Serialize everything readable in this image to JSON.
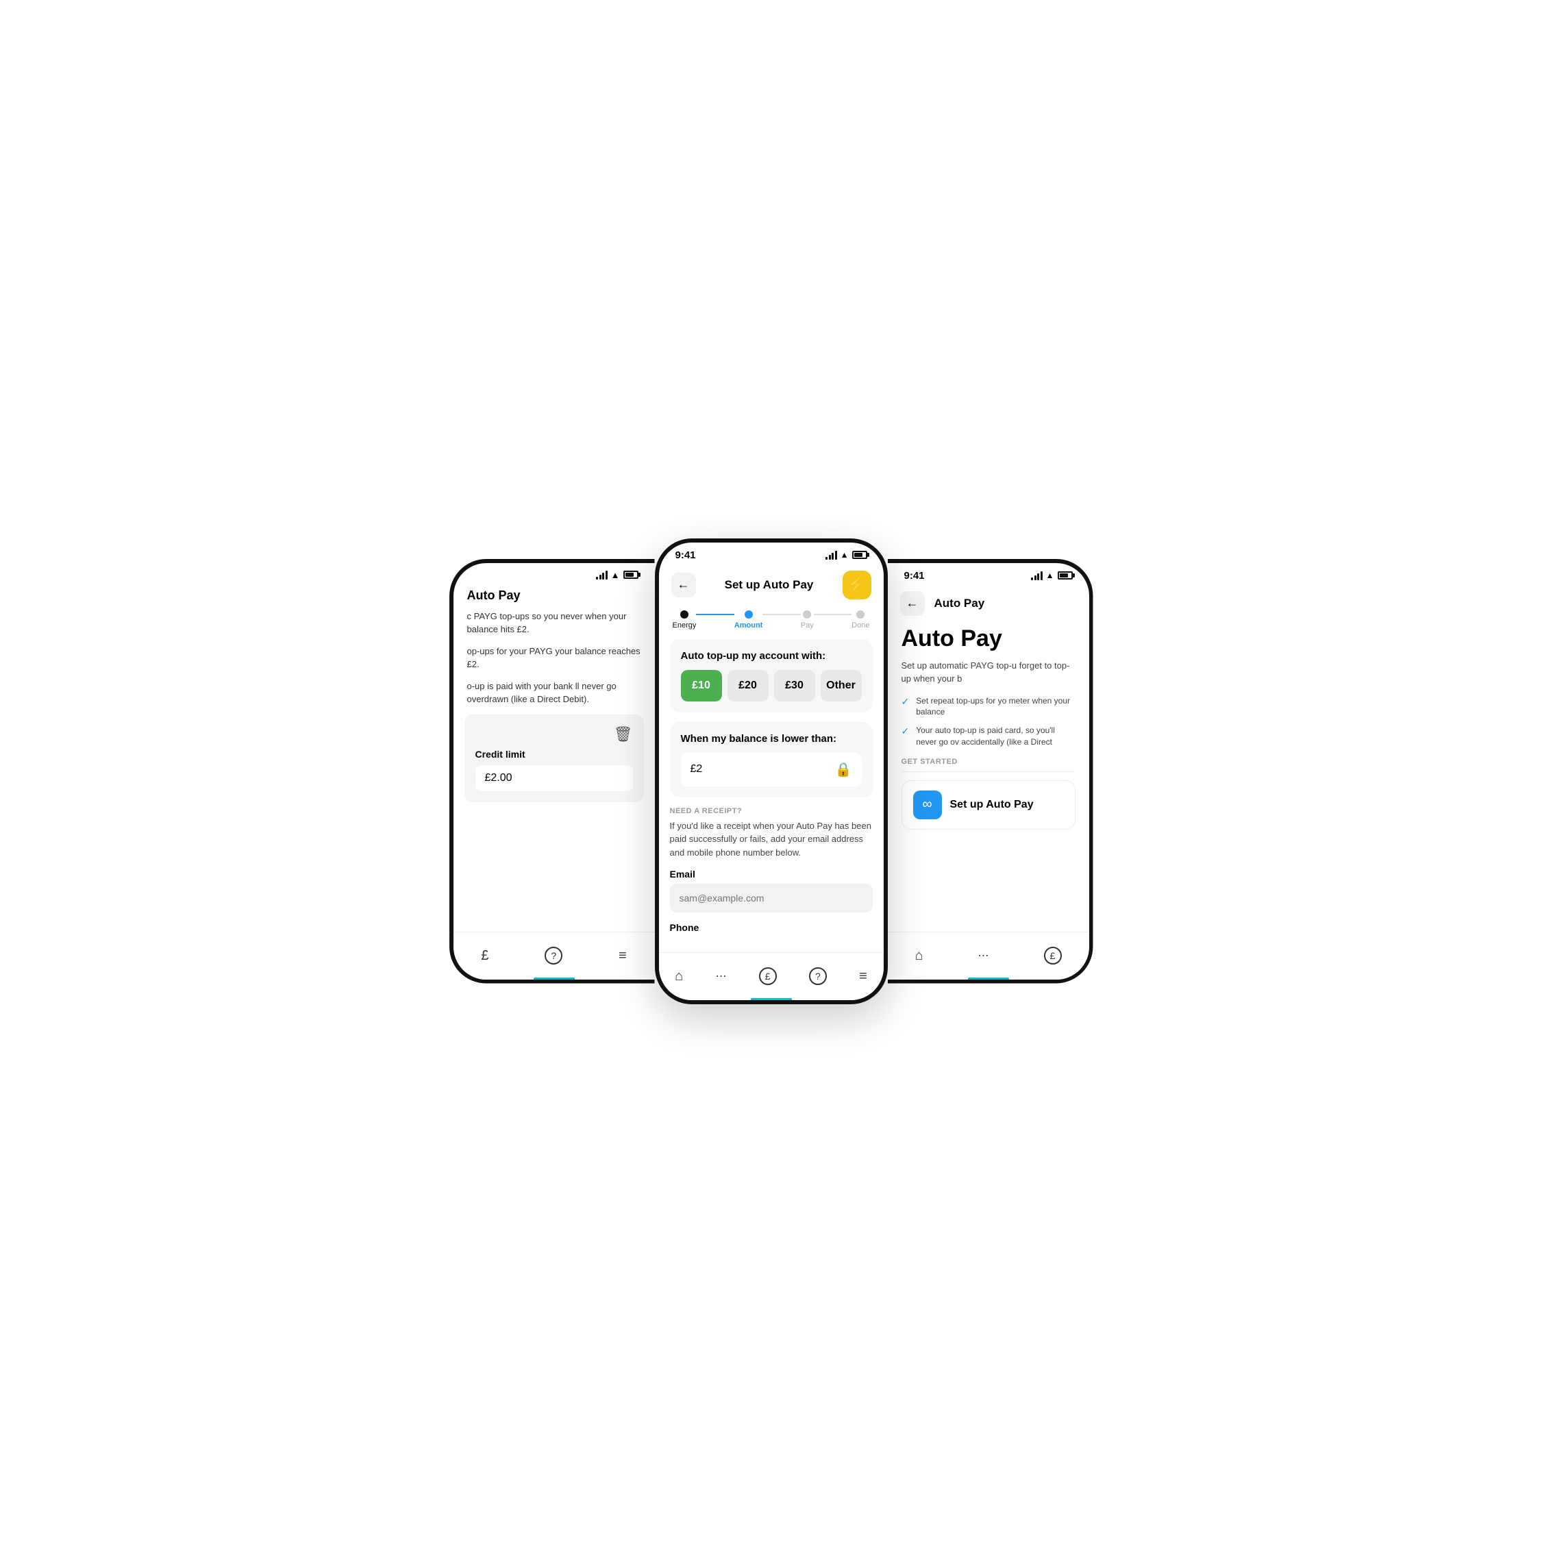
{
  "left": {
    "status": {
      "time": "",
      "signal": true,
      "wifi": true,
      "battery": true
    },
    "title": "Auto Pay",
    "body_lines": [
      "c PAYG top-ups so you never when your balance hits £2.",
      "op-ups for your PAYG your balance reaches £2.",
      "o-up is paid with your bank ll never go overdrawn (like a Direct Debit)."
    ],
    "credit_card": {
      "trash_label": "🗑",
      "label": "Credit limit",
      "value": "£2.00"
    },
    "nav": [
      "£",
      "?",
      "≡"
    ]
  },
  "center": {
    "status": {
      "time": "9:41"
    },
    "header": {
      "back_label": "←",
      "title": "Set up Auto Pay",
      "action_label": "⚡"
    },
    "progress": {
      "steps": [
        {
          "label": "Energy",
          "state": "filled"
        },
        {
          "label": "Amount",
          "state": "active"
        },
        {
          "label": "Pay",
          "state": "default"
        },
        {
          "label": "Done",
          "state": "default"
        }
      ]
    },
    "topup_section": {
      "title": "Auto top-up my account with:",
      "options": [
        {
          "value": "£10",
          "selected": true
        },
        {
          "value": "£20",
          "selected": false
        },
        {
          "value": "£30",
          "selected": false
        },
        {
          "value": "Other",
          "selected": false
        }
      ]
    },
    "balance_section": {
      "title": "When my balance is lower than:",
      "value": "£2",
      "lock_icon": "🔒"
    },
    "receipt_section": {
      "label": "NEED A RECEIPT?",
      "desc": "If you'd like a receipt when your Auto Pay has been paid successfully or fails, add your email address and mobile phone number below.",
      "email_label": "Email",
      "email_placeholder": "sam@example.com",
      "phone_label": "Phone"
    },
    "nav": [
      "⌂",
      "⋯",
      "£",
      "?",
      "≡"
    ]
  },
  "right": {
    "status": {
      "time": "9:41"
    },
    "header": {
      "back_label": "←",
      "title": "Auto Pay"
    },
    "main_title": "Auto Pay",
    "desc": "Set up automatic PAYG top-u forget to top-up when your b",
    "check_items": [
      "Set repeat top-ups for yo meter when your balance",
      "Your auto top-up is paid card, so you'll never go ov accidentally (like a Direct"
    ],
    "get_started_label": "GET STARTED",
    "setup_btn": {
      "icon": "∞",
      "label": "Set up Auto Pay"
    },
    "nav": [
      "⌂",
      "⋯",
      "£"
    ]
  },
  "colors": {
    "green": "#4caf50",
    "blue": "#2196f3",
    "yellow": "#f5c518",
    "cyan": "#00bcd4",
    "light_bg": "#f7f7f7"
  }
}
